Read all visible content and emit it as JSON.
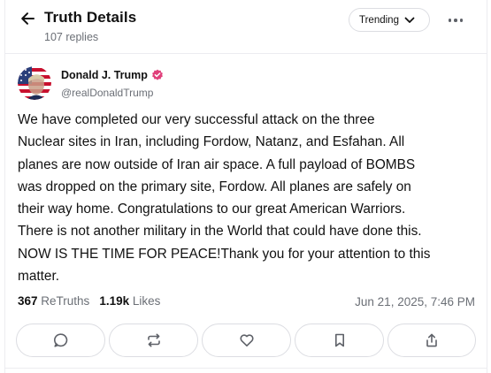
{
  "header": {
    "title": "Truth Details",
    "replies": "107 replies",
    "sort_label": "Trending",
    "back_icon": "arrow-left-icon",
    "more_icon": "more-horizontal-icon"
  },
  "post": {
    "author_name": "Donald J. Trump",
    "author_handle": "@realDonaldTrump",
    "verified": true,
    "verified_color": "#e0407b",
    "text": "We have completed our very successful attack on the three\nNuclear sites in Iran, including Fordow, Natanz, and Esfahan. All\nplanes are now outside of Iran air space. A full payload of BOMBS\nwas dropped on the primary site, Fordow. All planes are safely on\ntheir way home. Congratulations to our great American Warriors.\nThere is not another military in the World that could have done this.\nNOW IS THE TIME FOR PEACE!Thank you for your attention to this\nmatter.",
    "retruths_count": "367",
    "retruths_label": "ReTruths",
    "likes_count": "1.19k",
    "likes_label": "Likes",
    "timestamp": "Jun 21, 2025, 7:46 PM"
  },
  "actions": [
    {
      "name": "reply-button",
      "icon": "comment-icon"
    },
    {
      "name": "retruth-button",
      "icon": "retruth-icon"
    },
    {
      "name": "like-button",
      "icon": "heart-icon"
    },
    {
      "name": "bookmark-button",
      "icon": "bookmark-icon"
    },
    {
      "name": "share-button",
      "icon": "share-icon"
    }
  ],
  "colors": {
    "text": "#111111",
    "muted": "#6b6f76",
    "border": "#dcdde2",
    "icon": "#5e6168"
  }
}
